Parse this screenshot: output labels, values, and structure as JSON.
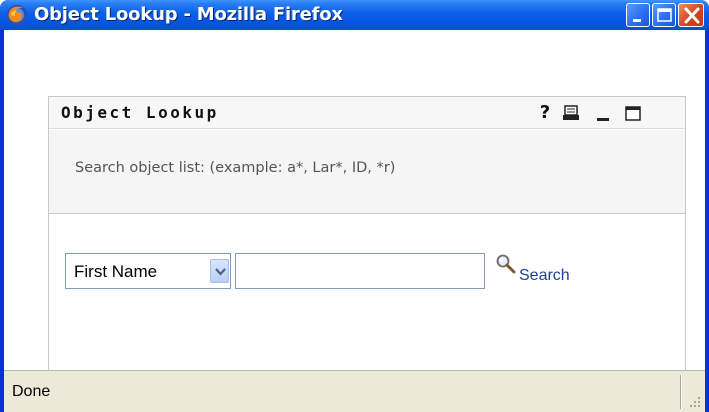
{
  "window": {
    "title": "Object Lookup - Mozilla Firefox",
    "app_icon": "firefox-icon",
    "controls": [
      "minimize-icon",
      "maximize-icon",
      "close-icon"
    ]
  },
  "portlet": {
    "title": "Object Lookup",
    "header_icons": {
      "help": "?",
      "print": "print-icon",
      "minimize": "minimize-icon",
      "maximize": "maximize-icon"
    },
    "hint": "Search object list: (example: a*, Lar*, ID, *r)"
  },
  "search": {
    "field_select_value": "First Name",
    "input_value": "",
    "input_placeholder": "",
    "button_label": "Search",
    "button_icon": "magnifier-icon"
  },
  "status_bar": {
    "text": "Done"
  },
  "colors": {
    "titlebar": "#0654dd",
    "link": "#1c3fa0",
    "status_bar": "#ece9d8"
  }
}
